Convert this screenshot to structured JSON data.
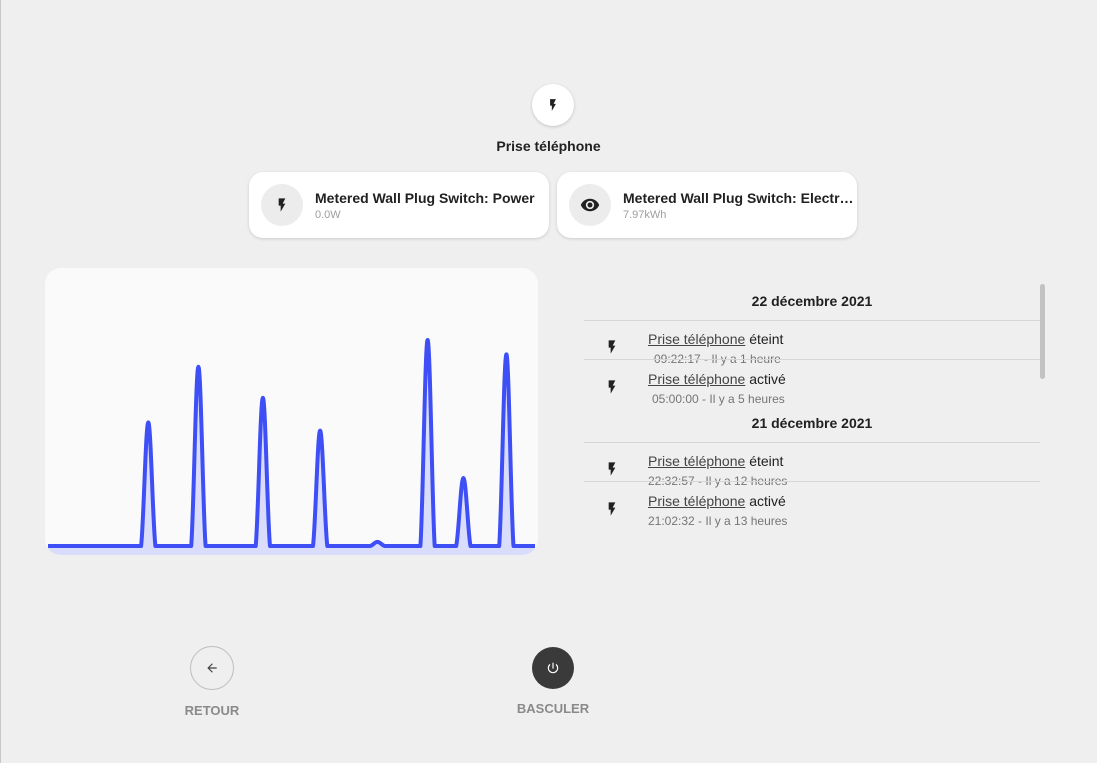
{
  "device": {
    "title": "Prise téléphone",
    "icon": "flash-icon"
  },
  "cards": [
    {
      "name": "Metered Wall Plug Switch: Power",
      "value": "0.0W",
      "icon": "flash-icon"
    },
    {
      "name": "Metered Wall Plug Switch: Electric ...",
      "value": "7.97kWh",
      "icon": "eye-icon"
    }
  ],
  "chart_data": {
    "type": "area",
    "series": [
      {
        "values": [
          0,
          0,
          0,
          0,
          0,
          0,
          0,
          0,
          0,
          0,
          0,
          0,
          0,
          0,
          0.6,
          0,
          0,
          0,
          0,
          0,
          0,
          0.87,
          0,
          0,
          0,
          0,
          0,
          0,
          0,
          0,
          0.72,
          0,
          0,
          0,
          0,
          0,
          0,
          0,
          0.56,
          0,
          0,
          0,
          0,
          0,
          0,
          0,
          0.02,
          0,
          0,
          0,
          0,
          0,
          0,
          1.0,
          0,
          0,
          0,
          0,
          0.33,
          0,
          0,
          0,
          0,
          0,
          0.93,
          0,
          0,
          0,
          0
        ]
      }
    ],
    "colors": {
      "line": "#3d4ff5",
      "fill": "#d9dcfb"
    },
    "grid": false,
    "axes_visible": false
  },
  "logbook": {
    "groups": [
      {
        "date": "22 décembre 2021",
        "entries": [
          {
            "entity": "Prise téléphone",
            "action": "éteint",
            "time": "09:22:17 - Il y a 1 heure"
          },
          {
            "entity": "Prise téléphone",
            "action": "activé",
            "time": "05:00:00 - Il y a 5 heures"
          }
        ]
      },
      {
        "date": "21 décembre 2021",
        "entries": [
          {
            "entity": "Prise téléphone",
            "action": "éteint",
            "time": "22:32:57 - Il y a 12 heures"
          },
          {
            "entity": "Prise téléphone",
            "action": "activé",
            "time": "21:02:32 - Il y a 13 heures"
          }
        ]
      }
    ]
  },
  "actions": {
    "back_label": "RETOUR",
    "toggle_label": "BASCULER"
  }
}
